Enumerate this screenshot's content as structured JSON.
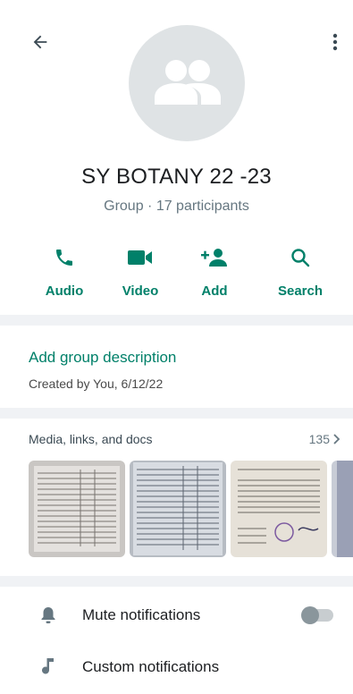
{
  "group": {
    "name": "SY BOTANY 22 -23",
    "subtitle": "Group · 17 participants"
  },
  "actions": [
    {
      "label": "Audio",
      "icon": "phone-icon"
    },
    {
      "label": "Video",
      "icon": "video-camera-icon"
    },
    {
      "label": "Add",
      "icon": "add-person-icon"
    },
    {
      "label": "Search",
      "icon": "search-icon"
    }
  ],
  "description": {
    "add_label": "Add group description",
    "created": "Created by You, 6/12/22"
  },
  "media": {
    "title": "Media, links, and docs",
    "count": "135"
  },
  "settings": {
    "mute_label": "Mute notifications",
    "custom_label": "Custom notifications",
    "mute_enabled": false
  },
  "colors": {
    "accent": "#008069",
    "avatar_bg": "#dfe3e5",
    "section_gap": "#f0f2f5"
  }
}
